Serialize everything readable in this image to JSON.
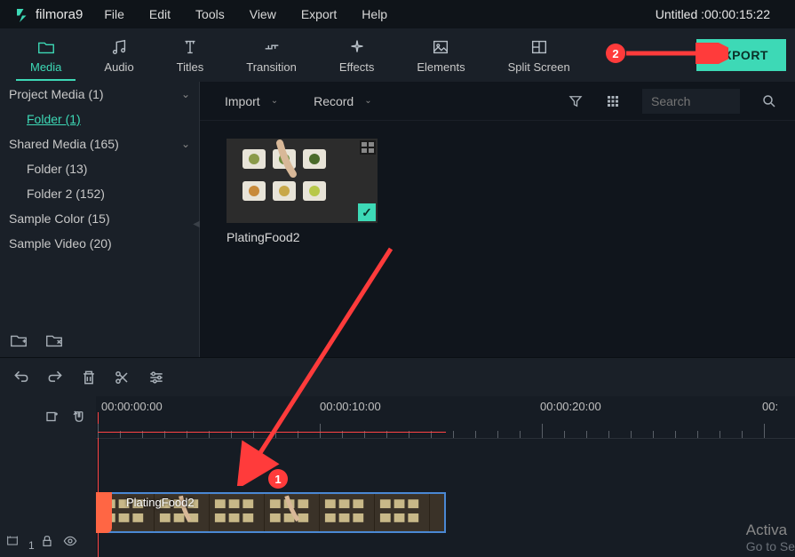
{
  "app": {
    "logo_text": "filmora9",
    "project_title": "Untitled :00:00:15:22"
  },
  "menu": {
    "file": "File",
    "edit": "Edit",
    "tools": "Tools",
    "view": "View",
    "export": "Export",
    "help": "Help"
  },
  "toolbar": {
    "media": "Media",
    "audio": "Audio",
    "titles": "Titles",
    "transition": "Transition",
    "effects": "Effects",
    "elements": "Elements",
    "split_screen": "Split Screen",
    "export_btn": "EXPORT"
  },
  "sidebar": {
    "project_media": "Project Media (1)",
    "folder_link": "Folder (1)",
    "shared_media": "Shared Media (165)",
    "folder_13": "Folder (13)",
    "folder_2_152": "Folder 2 (152)",
    "sample_color": "Sample Color (15)",
    "sample_video": "Sample Video (20)"
  },
  "content_toolbar": {
    "import": "Import",
    "record": "Record",
    "search_placeholder": "Search"
  },
  "media": {
    "item1_name": "PlatingFood2"
  },
  "timeline": {
    "ruler": {
      "t0": "00:00:00:00",
      "t1": "00:00:10:00",
      "t2": "00:00:20:00",
      "t3": "00:"
    },
    "clip_name": "PlatingFood2"
  },
  "annotations": {
    "badge1": "1",
    "badge2": "2"
  },
  "watermark": {
    "title": "Activa",
    "subtitle": "Go to Se"
  }
}
